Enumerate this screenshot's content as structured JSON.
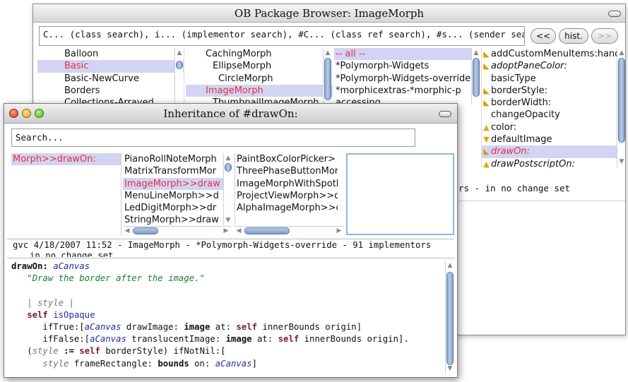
{
  "back_window": {
    "title": "OB Package Browser: ImageMorph",
    "search_text": "C... (class search), i... (implementor search), #C... (class ref search), #s... (sender search)",
    "nav": {
      "back": "<<",
      "history": "hist.",
      "forward": ">>"
    },
    "packages": [
      "Balloon",
      "Basic",
      "Basic-NewCurve",
      "Borders",
      "Collections-Arrayed"
    ],
    "classes": [
      "CachingMorph",
      "EllipseMorph",
      "CircleMorph",
      "ImageMorph",
      "ThumbnailImageMorph"
    ],
    "categories": [
      "-- all --",
      "*Polymorph-Widgets",
      "*Polymorph-Widgets-override",
      "*morphicextras-*morphic-p",
      "accessing"
    ],
    "methods": [
      {
        "label": "addCustomMenuItems:hand",
        "icon": "override-icon",
        "italic": false
      },
      {
        "label": "adoptPaneColor:",
        "icon": "override-icon",
        "italic": true
      },
      {
        "label": "basicType",
        "icon": "",
        "italic": false
      },
      {
        "label": "borderStyle:",
        "icon": "override-icon",
        "italic": false
      },
      {
        "label": "borderWidth:",
        "icon": "override-icon",
        "italic": false
      },
      {
        "label": "changeOpacity",
        "icon": "",
        "italic": false
      },
      {
        "label": "color:",
        "icon": "up-arrow-icon",
        "italic": false
      },
      {
        "label": "defaultImage",
        "icon": "down-arrow-icon",
        "italic": false
      },
      {
        "label": "drawOn:",
        "icon": "override-icon",
        "italic": true
      },
      {
        "label": "drawPostscriptOn:",
        "icon": "up-arrow-icon",
        "italic": true
      }
    ],
    "status_text": "rs - in no change set"
  },
  "front_window": {
    "title": "Inheritance of #drawOn:",
    "search_placeholder": "Search...",
    "supers": [
      "Morph>>drawOn:"
    ],
    "implementors_a": [
      "PianoRollNoteMorph",
      "MatrixTransformMor",
      "ImageMorph>>draw",
      "MenuLineMorph>>d",
      "LedDigitMorph>>dr",
      "StringMorph>>draw"
    ],
    "implementors_b": [
      "PaintBoxColorPicker>",
      "ThreePhaseButtonMor",
      "ImageMorphWithSpotl",
      "ProjectViewMorph>>d",
      "AlphaImageMorph>>d"
    ],
    "info_line": "gvc 4/18/2007 11:52 - ImageMorph - *Polymorph-Widgets-override - 91 implementors",
    "info_line2": "in no change set",
    "code": {
      "selector": "drawOn:",
      "arg": "aCanvas",
      "comment": "\"Draw the border after the image.\"",
      "temps": "| style |",
      "self_kw": "self",
      "is_opaque": "isOpaque",
      "if_true": "ifTrue:[",
      "draw_image": "drawImage:",
      "image_kw": "image",
      "at_kw": "at:",
      "inner_bounds": "innerBounds origin]",
      "if_false": "ifFalse:[",
      "translucent_image": "translucentImage:",
      "inner_bounds_end": "innerBounds origin].",
      "open_paren": "(",
      "style_tmp": "style",
      "assign": ":=",
      "border_style": "borderStyle) ifNotNil:[",
      "frame_rect": "frameRectangle:",
      "bounds_kw": "bounds",
      "on_kw": "on:",
      "close": "]"
    }
  }
}
